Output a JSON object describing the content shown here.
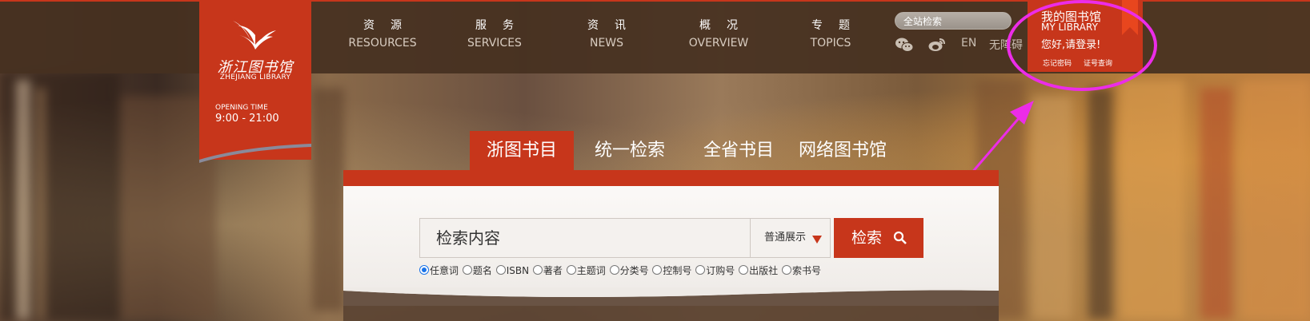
{
  "logo": {
    "cn": "浙江图书馆",
    "en": "ZHEJIANG LIBRARY",
    "opening_label": "OPENING TIME",
    "opening_time": "9:00 - 21:00"
  },
  "nav": [
    {
      "cn": "资源",
      "en": "RESOURCES"
    },
    {
      "cn": "服务",
      "en": "SERVICES"
    },
    {
      "cn": "资讯",
      "en": "NEWS"
    },
    {
      "cn": "概况",
      "en": "OVERVIEW"
    },
    {
      "cn": "专题",
      "en": "TOPICS"
    }
  ],
  "site_search": {
    "placeholder": "全站检索"
  },
  "utilities": {
    "lang": "EN",
    "accessible": "无障碍"
  },
  "my_library": {
    "title": "我的图书馆",
    "en": "MY LIBRARY",
    "greeting": "您好,请登录!",
    "forgot": "忘记密码",
    "card_query": "证号查询"
  },
  "tabs": [
    {
      "label": "浙图书目",
      "active": true
    },
    {
      "label": "统一检索",
      "active": false
    },
    {
      "label": "全省书目",
      "active": false
    },
    {
      "label": "网络图书馆",
      "active": false
    }
  ],
  "search": {
    "input_value": "检索内容",
    "mode": "普通展示",
    "button": "检索"
  },
  "search_fields": [
    {
      "label": "任意词",
      "checked": true
    },
    {
      "label": "题名",
      "checked": false
    },
    {
      "label": "ISBN",
      "checked": false
    },
    {
      "label": "著者",
      "checked": false
    },
    {
      "label": "主题词",
      "checked": false
    },
    {
      "label": "分类号",
      "checked": false
    },
    {
      "label": "控制号",
      "checked": false
    },
    {
      "label": "订购号",
      "checked": false
    },
    {
      "label": "出版社",
      "checked": false
    },
    {
      "label": "索书号",
      "checked": false
    }
  ],
  "colors": {
    "brand_red": "#c7361b",
    "annotation_magenta": "#ec2ce8"
  }
}
